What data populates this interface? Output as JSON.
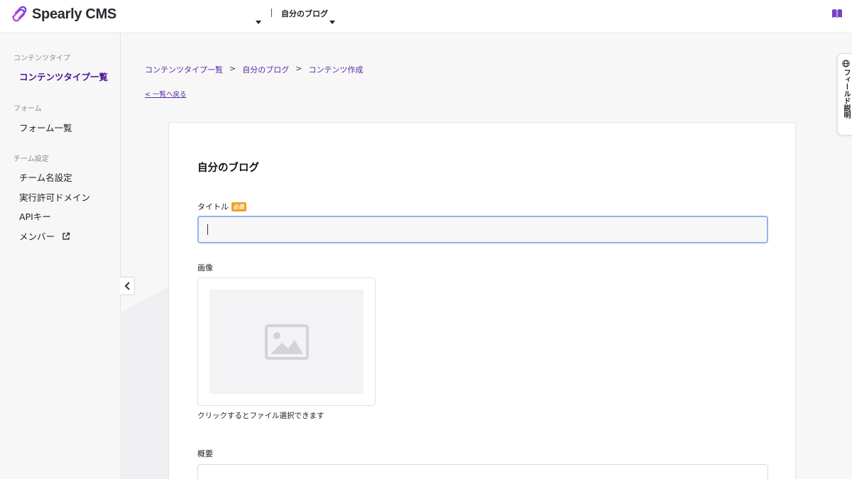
{
  "header": {
    "app_name": "Spearly CMS",
    "site_name": "自分のブログ",
    "logo_icon": "spearly-logo-icon",
    "book_icon": "book-icon",
    "accent_color": "#7b3fc4"
  },
  "sidebar": {
    "sections": [
      {
        "title": "コンテンツタイプ",
        "items": [
          {
            "label": "コンテンツタイプ一覧",
            "active": true
          }
        ]
      },
      {
        "title": "フォーム",
        "items": [
          {
            "label": "フォーム一覧"
          }
        ]
      },
      {
        "title": "チーム設定",
        "items": [
          {
            "label": "チーム名設定"
          },
          {
            "label": "実行許可ドメイン"
          },
          {
            "label": "APIキー"
          },
          {
            "label": "メンバー",
            "icon": "external-link-icon"
          }
        ]
      }
    ]
  },
  "breadcrumb": {
    "items": [
      "コンテンツタイプ一覧",
      "自分のブログ",
      "コンテンツ作成"
    ],
    "separator": ">"
  },
  "back_link": "< 一覧へ戻る",
  "form": {
    "title": "自分のブログ",
    "title_field": {
      "label": "タイトル",
      "required_badge": "必須",
      "value": ""
    },
    "image_field": {
      "label": "画像",
      "hint": "クリックするとファイル選択できます"
    },
    "summary_field": {
      "label": "概要"
    }
  },
  "field_tab": {
    "label": "フィールド説明",
    "icon": "globe-icon"
  }
}
